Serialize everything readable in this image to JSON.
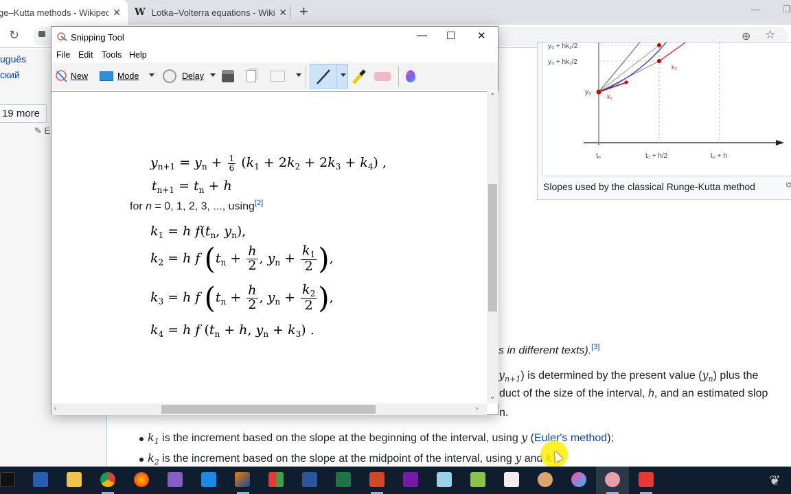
{
  "browser": {
    "tabs": [
      {
        "title": "ge–Kutta methods - Wikiped",
        "favicon": "W",
        "active": true
      },
      {
        "title": "Lotka–Volterra equations - Wikip",
        "favicon": "W",
        "active": false
      }
    ],
    "new_tab_label": "+",
    "close_glyph": "✕"
  },
  "wiki": {
    "languages": [
      "uguês",
      "ский"
    ],
    "more_languages": "19 more",
    "edit_links": "E",
    "figure": {
      "caption": "Slopes used by the classical Runge-Kutta method",
      "y_labels": [
        "y₀ + hk₂/2",
        "y₀ + hk₁/2",
        "y₀"
      ],
      "x_labels": [
        "t₀",
        "t₀ + h/2",
        "t₀ + h"
      ],
      "slope_labels": [
        "k₁",
        "k₂"
      ]
    },
    "paragraphs": {
      "p1_tail": "s in different texts).",
      "p1_ref": "[3]",
      "p2_line1_a": ") is determined by the present value (",
      "p2_line1_b": ") plus the",
      "p2_line2": "duct of the size of the interval, ",
      "p2_line2_h": "h",
      "p2_line2_b": ", and an estimated slop",
      "p2_line3": "n."
    },
    "bullets": [
      {
        "var": "k",
        "sub": "1",
        "text": " is the increment based on the slope at the beginning of the interval, using ",
        "math": "y",
        "link": "Euler's method",
        "end": ");",
        "open": " ("
      },
      {
        "var": "k",
        "sub": "2",
        "text": " is the increment based on the slope at the midpoint of the interval, using ",
        "math": "y",
        "and": " and ",
        "var2": "k",
        "sub2": "1",
        "end": ";"
      }
    ]
  },
  "snipping_tool": {
    "title": "Snipping Tool",
    "menu": [
      "File",
      "Edit",
      "Tools",
      "Help"
    ],
    "toolbar": {
      "new": "New",
      "mode": "Mode",
      "delay": "Delay"
    },
    "window_controls": {
      "minimize": "—",
      "maximize": "☐",
      "close": "✕"
    },
    "content": {
      "for_line": {
        "pre": "for ",
        "n": "n",
        "post": " = 0, 1, 2, 3, ..., using",
        "ref": "[2]"
      }
    }
  },
  "taskbar": {
    "apps": [
      "command-prompt",
      "powershell",
      "file-explorer",
      "chrome",
      "firefox",
      "visual-studio",
      "vs-code",
      "matlab",
      "app-grid",
      "word",
      "excel",
      "powerpoint",
      "onenote",
      "notepad",
      "notepad-plus",
      "calculator",
      "paint",
      "paint-3d",
      "snipping-tool",
      "camtasia"
    ]
  }
}
